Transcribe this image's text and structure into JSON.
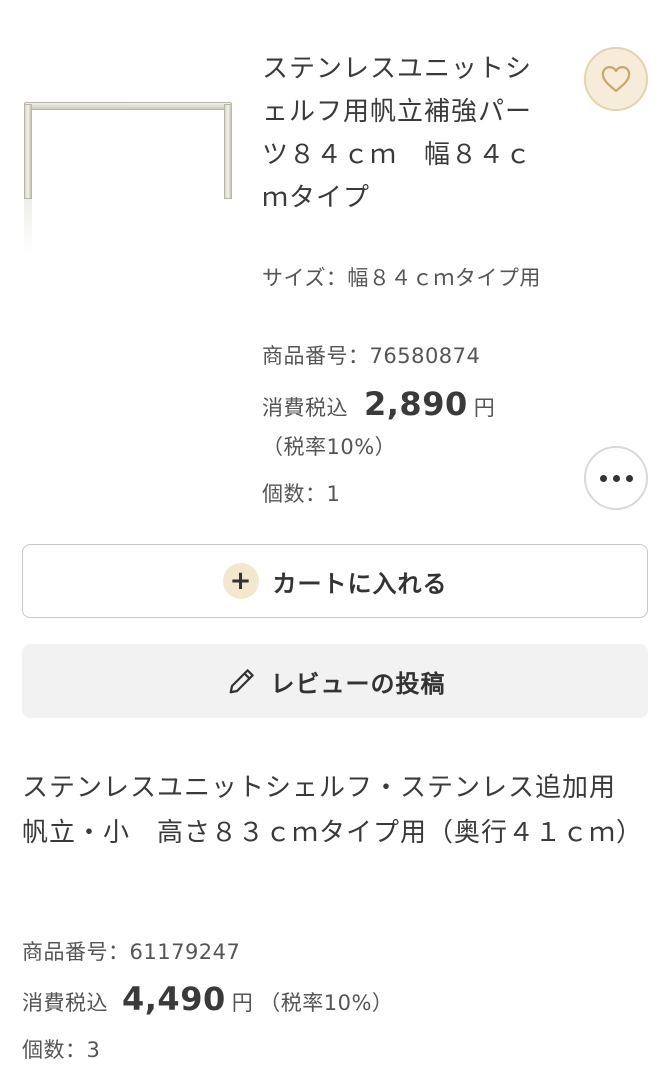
{
  "item1": {
    "image_icon": "stainless-frame-image",
    "title": "ステンレスユニットシェルフ用帆立補強パーツ８４ｃｍ　幅８４ｃｍタイプ",
    "size": "サイズ：幅８４ｃｍタイプ用",
    "code": "商品番号：76580874",
    "price_label": "消費税込",
    "price_value": "2,890",
    "price_unit": "円",
    "tax_rate": "（税率10%）",
    "quantity": "個数：1",
    "favorite_icon": "heart-icon",
    "more_icon": "ellipsis-icon"
  },
  "actions": {
    "cart_label": "カートに入れる",
    "cart_icon": "plus-icon",
    "review_label": "レビューの投稿",
    "review_icon": "pencil-icon"
  },
  "item2": {
    "title": "ステンレスユニットシェルフ・ステンレス追加用帆立・小　高さ８３ｃｍタイプ用（奥行４１ｃｍ）",
    "code": "商品番号：61179247",
    "price_label": "消費税込",
    "price_value": "4,490",
    "price_unit": "円",
    "tax_rate": "（税率10%）",
    "quantity": "個数：3"
  },
  "colors": {
    "favorite_bg": "#f6ecd9",
    "plus_bg": "#f3e7cf",
    "review_bg": "#f2f2f2"
  }
}
